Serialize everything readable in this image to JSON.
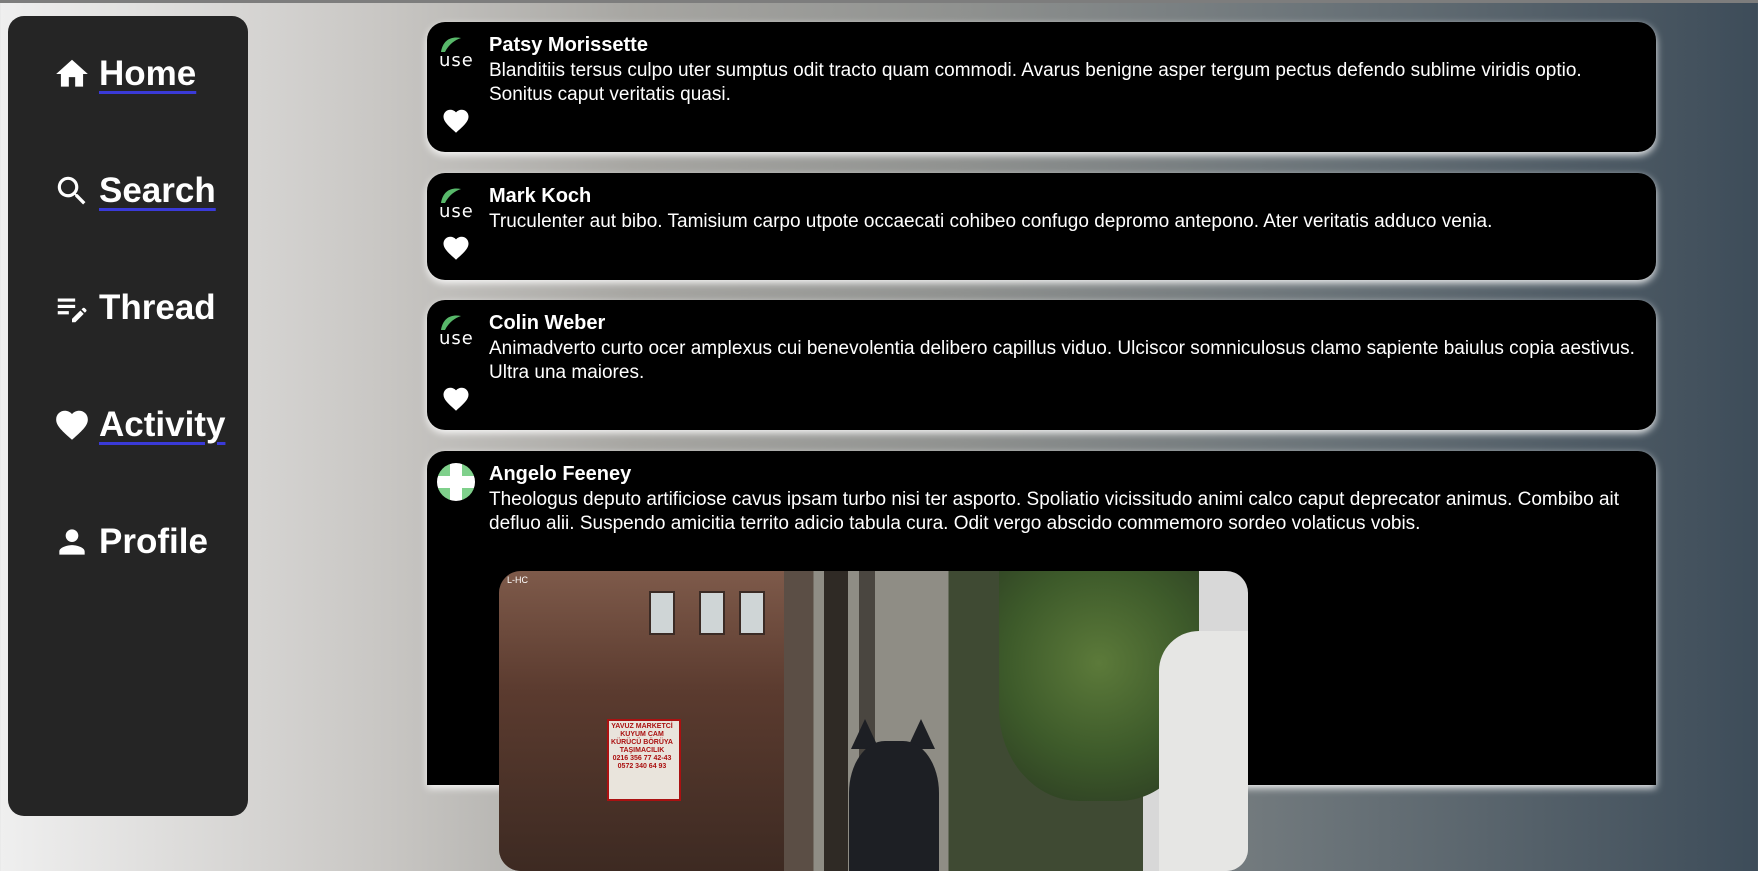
{
  "nav": {
    "items": [
      {
        "label": "Home",
        "icon": "home-icon"
      },
      {
        "label": "Search",
        "icon": "search-icon"
      },
      {
        "label": "Thread",
        "icon": "edit-note-icon"
      },
      {
        "label": "Activity",
        "icon": "heart-icon"
      },
      {
        "label": "Profile",
        "icon": "person-icon"
      }
    ]
  },
  "posts": [
    {
      "author": "Patsy Morissette",
      "text": "Blanditiis tersus culpo uter sumptus odit tracto quam commodi. Avarus benigne asper tergum pectus defendo sublime viridis optio. Sonitus caput veritatis quasi.",
      "avatar_alt": "use"
    },
    {
      "author": "Mark Koch",
      "text": "Truculenter aut bibo. Tamisium carpo utpote occaecati cohibeo confugo depromo antepono. Ater veritatis adduco venia.",
      "avatar_alt": "use"
    },
    {
      "author": "Colin Weber",
      "text": "Animadverto curto ocer amplexus cui benevolentia delibero capillus viduo. Ulciscor somniculosus clamo sapiente baiulus copia aestivus. Ultra una maiores.",
      "avatar_alt": "use"
    },
    {
      "author": "Angelo Feeney",
      "text": "Theologus deputo artificiose cavus ipsam turbo nisi ter asporto. Spoliatio vicissitudo animi calco caput deprecator animus. Combibo ait defluo alii. Suspendo amicitia territo adicio tabula cura. Odit vergo abscido commemoro sordeo volaticus vobis.",
      "image_caption": "L-HC",
      "sign_text": "YAVUZ MARKETCİ KUYUM CAM KÜRÜCÜ BÖRÜYA TAŞIMACILIK 0216 356 77 42-43 0572 340 64 93"
    }
  ],
  "colors": {
    "sidebar": "#252525",
    "post_bg": "#000000",
    "link_underline": "#3a3ad8"
  }
}
